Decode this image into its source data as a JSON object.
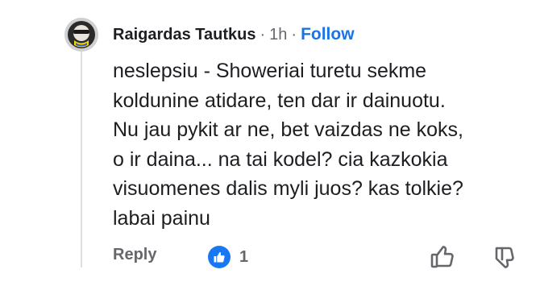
{
  "comment": {
    "author": "Raigardas Tautkus",
    "separator_1": "·",
    "time": "1h",
    "separator_2": "·",
    "follow_label": "Follow",
    "text_lines": [
      "neslepsiu - Showeriai turetu sekme",
      "koldunine atidare, ten dar ir dainuotu.",
      "Nu jau pykit ar ne, bet vaizdas ne koks,",
      "o ir daina... na tai kodel? cia kazkokia",
      "visuomenes dalis myli juos? kas tolkie?",
      "labai painu"
    ],
    "actions": {
      "reply_label": "Reply",
      "reaction_icon": "like-icon",
      "reaction_count": "1",
      "upvote_icon": "thumbs-up-outline-icon",
      "downvote_icon": "thumbs-down-outline-icon"
    }
  },
  "colors": {
    "follow": "#1b74e4",
    "like_badge": "#1877f2",
    "muted_text": "#65676b",
    "primary_text": "#1c1e21"
  }
}
